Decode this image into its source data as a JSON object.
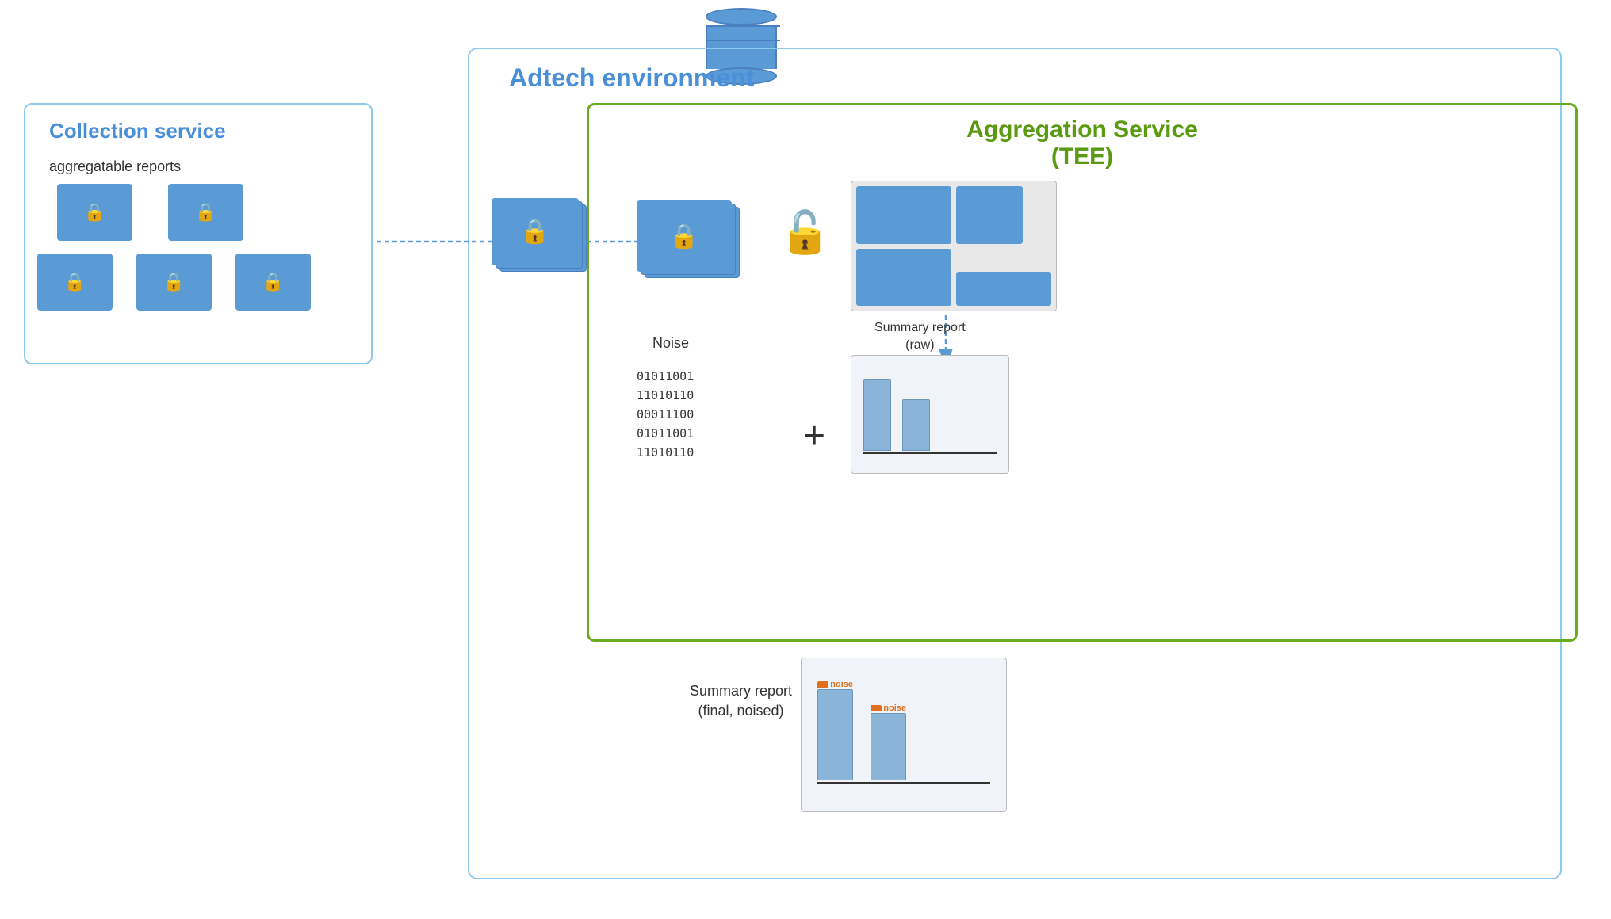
{
  "adtech": {
    "label": "Adtech environment"
  },
  "collection": {
    "label": "Collection service",
    "sub_label": "aggregatable reports"
  },
  "aggregation": {
    "label": "Aggregation Service",
    "label2": "(TEE)"
  },
  "noise": {
    "label": "Noise",
    "binary1": "01011001",
    "binary2": "11010110",
    "binary3": "00011100",
    "binary4": "01011001",
    "binary5": "11010110"
  },
  "summary_raw": {
    "label": "Summary report",
    "label2": "(raw)"
  },
  "summary_final": {
    "label": "Summary report",
    "label2": "(final, noised)"
  },
  "noise_bar_label": "noise"
}
